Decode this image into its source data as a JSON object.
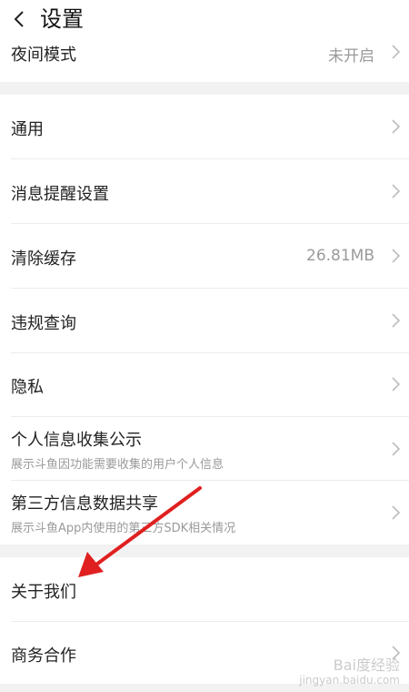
{
  "header": {
    "title": "设置"
  },
  "rows": {
    "night_mode": {
      "label": "夜间模式",
      "value": "未开启"
    },
    "general": {
      "label": "通用"
    },
    "notifications": {
      "label": "消息提醒设置"
    },
    "clear_cache": {
      "label": "清除缓存",
      "value": "26.81MB"
    },
    "violation": {
      "label": "违规查询"
    },
    "privacy": {
      "label": "隐私"
    },
    "personal_info": {
      "label": "个人信息收集公示",
      "sub": "展示斗鱼因功能需要收集的用户个人信息"
    },
    "third_party": {
      "label": "第三方信息数据共享",
      "sub": "展示斗鱼App内使用的第三方SDK相关情况"
    },
    "about": {
      "label": "关于我们"
    },
    "business": {
      "label": "商务合作"
    }
  },
  "watermark": {
    "text": "Bai度经验",
    "sub": "jingyan.baidu.com"
  },
  "colors": {
    "annotation_arrow": "#e02020",
    "section_gap": "#f2f2f2"
  }
}
